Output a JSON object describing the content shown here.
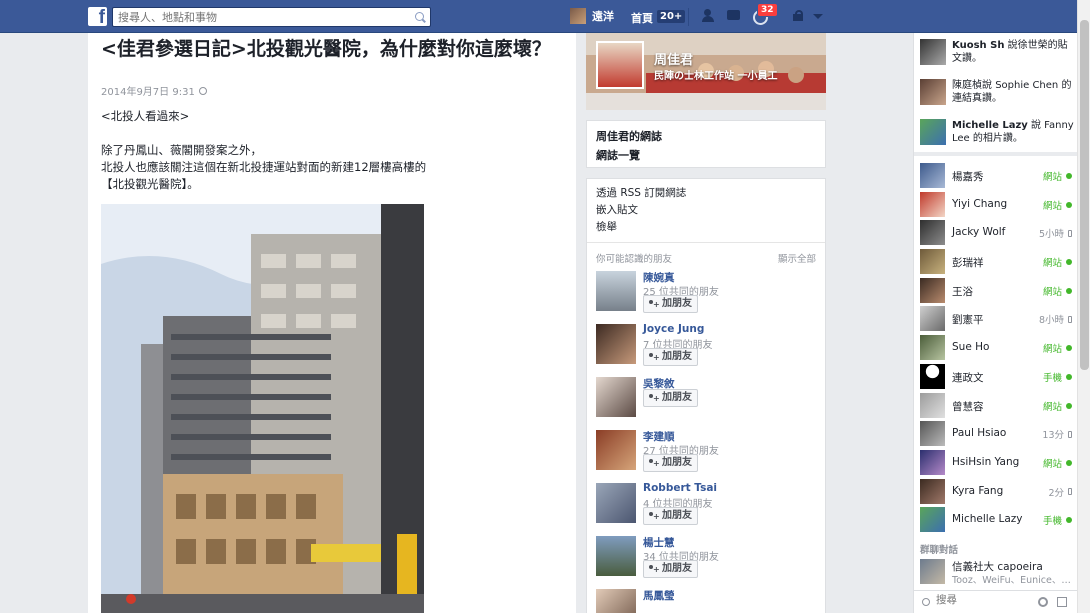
{
  "topbar": {
    "logo": "f",
    "search_placeholder": "搜尋人、地點和事物",
    "user_name": "遠洋",
    "home_label": "首頁",
    "home_badge": "20+",
    "notifications_count": "32",
    "icons": [
      "facebook-logo-icon",
      "search-icon",
      "friend-requests-icon",
      "messages-icon",
      "notifications-icon",
      "privacy-shortcuts-icon",
      "settings-caret-icon"
    ]
  },
  "article": {
    "title": "<佳君參選日記>北投觀光醫院，為什麼對你這麼壞？",
    "date": "2014年9月7日 9:31",
    "paragraphs": [
      "<北投人看過來>",
      "",
      "除了丹鳳山、薇閣開發案之外，",
      "北投人也應該關注這個在新北投捷運站對面的新建12層樓高樓的",
      "【北投觀光醫院】。"
    ]
  },
  "middle": {
    "cover_name": "周佳君",
    "cover_subtitle": "民陣の士林工作站 一小員工",
    "nav_links": [
      "周佳君的網誌",
      "網誌一覽"
    ],
    "links": [
      "透過 RSS 訂閱網誌",
      "嵌入貼文",
      "檢舉"
    ],
    "pymk": {
      "title": "你可能認識的朋友",
      "see_all": "顯示全部",
      "add_label": "加朋友",
      "people": [
        {
          "name": "陳婉真",
          "mutual": "25 位共同的朋友"
        },
        {
          "name": "Joyce Jung",
          "mutual": "7 位共同的朋友"
        },
        {
          "name": "吳黎敘",
          "mutual": ""
        },
        {
          "name": "李建順",
          "mutual": "27 位共同的朋友"
        },
        {
          "name": "Robbert Tsai",
          "mutual": "4 位共同的朋友"
        },
        {
          "name": "楊士慧",
          "mutual": "34 位共同的朋友"
        },
        {
          "name": "馬鳳瑩",
          "mutual": ""
        }
      ]
    }
  },
  "sidebar": {
    "ticker": [
      {
        "actor": "Kuosh Sh",
        "text": "說徐世榮的貼文讚。"
      },
      {
        "actor": "陳庭楨說",
        "text": "Sophie Chen 的連結真讚。"
      },
      {
        "actor": "Michelle Lazy",
        "text": "說 Fanny Lee 的相片讚。"
      }
    ],
    "chat": [
      {
        "name": "楊嘉秀",
        "status": "網站",
        "kind": "online"
      },
      {
        "name": "Yiyi Chang",
        "status": "網站",
        "kind": "online"
      },
      {
        "name": "Jacky Wolf",
        "status": "5小時",
        "kind": "idle"
      },
      {
        "name": "彭瑞祥",
        "status": "網站",
        "kind": "online"
      },
      {
        "name": "王浴",
        "status": "網站",
        "kind": "online"
      },
      {
        "name": "劉憲平",
        "status": "8小時",
        "kind": "idle"
      },
      {
        "name": "Sue Ho",
        "status": "網站",
        "kind": "online"
      },
      {
        "name": "連政文",
        "status": "手機",
        "kind": "online"
      },
      {
        "name": "曾慧容",
        "status": "網站",
        "kind": "online"
      },
      {
        "name": "Paul Hsiao",
        "status": "13分",
        "kind": "idle"
      },
      {
        "name": "HsiHsin Yang",
        "status": "網站",
        "kind": "online"
      },
      {
        "name": "Kyra Fang",
        "status": "2分",
        "kind": "idle"
      },
      {
        "name": "Michelle Lazy",
        "status": "手機",
        "kind": "online"
      }
    ],
    "group_heading": "群聊對話",
    "group_name": "信義社大 capoeira",
    "group_members": "Tooz、WeiFu、Eunice、…",
    "search_placeholder": "搜尋"
  }
}
